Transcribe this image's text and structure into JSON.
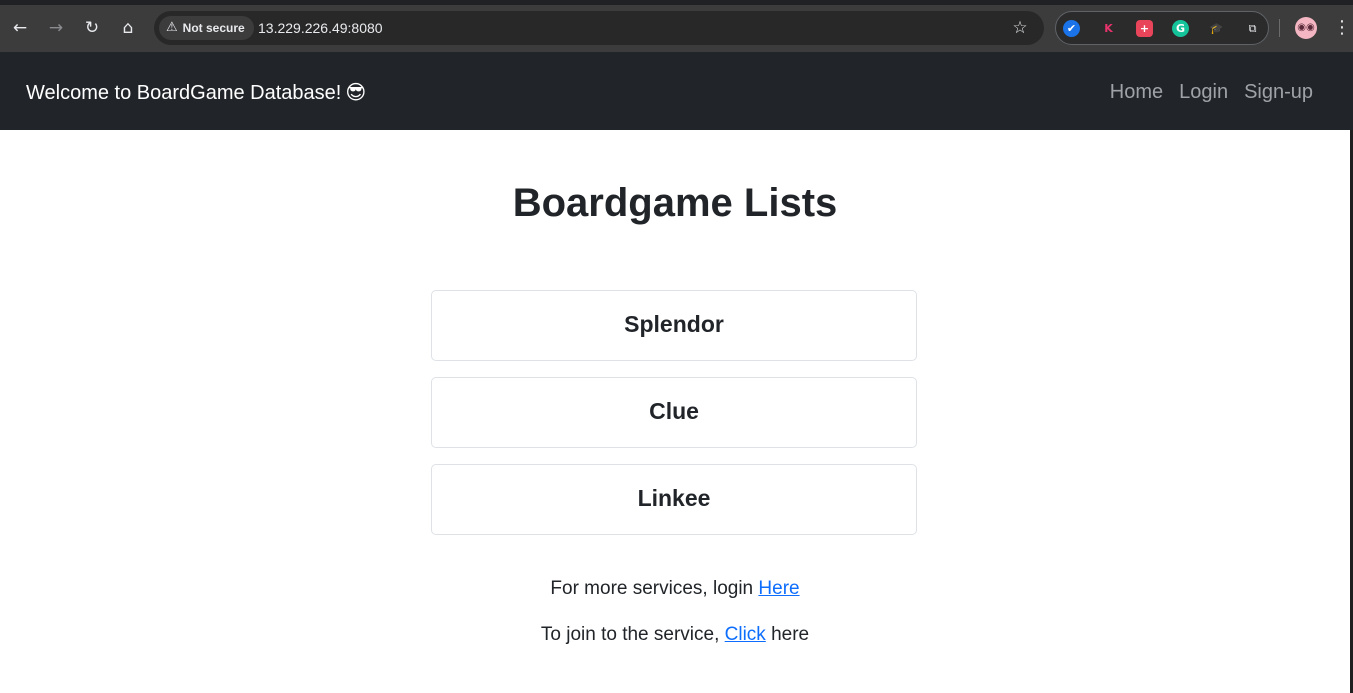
{
  "browser": {
    "security_label": "Not secure",
    "url": "13.229.226.49:8080",
    "icons": [
      "back-arrow-icon",
      "forward-arrow-icon",
      "reload-icon",
      "home-icon",
      "warning-icon",
      "star-icon",
      "extensions-puzzle-icon",
      "menu-dots-icon"
    ],
    "extensions": [
      {
        "name": "check-extension",
        "glyph": "✔",
        "color": "#1a73e8"
      },
      {
        "name": "k-extension",
        "glyph": "K",
        "color": "#e8336d"
      },
      {
        "name": "plus-extension",
        "glyph": "+",
        "color": "#e8455b"
      },
      {
        "name": "grammarly-extension",
        "glyph": "G",
        "color": "#15c39a"
      },
      {
        "name": "graduation-cap-extension",
        "glyph": "🎓",
        "color": "#1a8cff"
      }
    ]
  },
  "navbar": {
    "brand": "Welcome to BoardGame Database!",
    "brand_emoji": "😎",
    "links": [
      "Home",
      "Login",
      "Sign-up"
    ],
    "background": "#212529"
  },
  "main": {
    "title": "Boardgame Lists",
    "games": [
      "Splendor",
      "Clue",
      "Linkee"
    ],
    "login_prefix": "For more services, login ",
    "login_link": "Here",
    "join_prefix": "To join to the service, ",
    "join_link": "Click",
    "join_suffix": " here",
    "link_color": "#0d6efd"
  }
}
